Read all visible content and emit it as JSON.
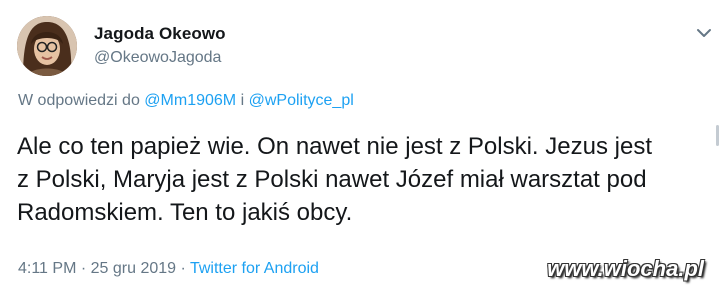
{
  "user": {
    "display_name": "Jagoda Okeowo",
    "handle": "@OkeowoJagoda",
    "avatar_icon": "profile-photo"
  },
  "reply": {
    "prefix": "W odpowiedzi do",
    "mention_1": "@Mm1906M",
    "conjunction": "i",
    "mention_2": "@wPolityce_pl"
  },
  "tweet": {
    "text": "Ale co ten papież wie. On nawet nie jest z Polski. Jezus jest z Polski, Maryja jest z Polski nawet Józef miał warsztat pod Radomskiem. Ten to jakiś obcy."
  },
  "meta": {
    "time": "4:11 PM",
    "date": "25 gru 2019",
    "separator": "·",
    "source": "Twitter for Android"
  },
  "watermark": "www.wiocha.pl",
  "colors": {
    "link": "#1da1f2",
    "secondary": "#657786",
    "primary": "#14171a"
  }
}
